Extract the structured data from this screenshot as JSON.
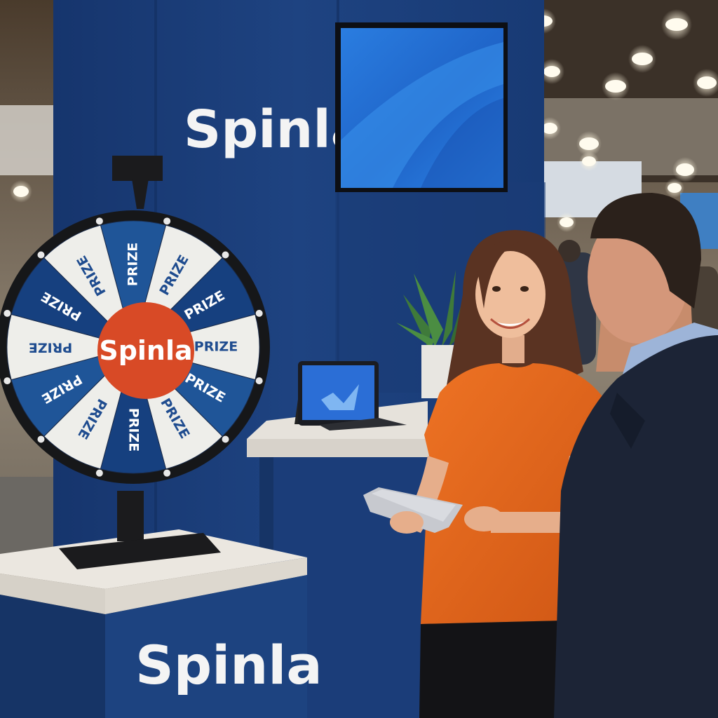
{
  "booth": {
    "brand_top": "Spinla",
    "brand_pedestal": "Spinla",
    "wheel_hub": "Spinla",
    "wheel_segments": [
      "PRIZE",
      "PRIZE",
      "PRIZE",
      "PRIZE",
      "PRIZE",
      "PRIZE",
      "PRIZE",
      "PRIZE",
      "PRIZE",
      "PRIZE",
      "PRIZE",
      "PRIZE"
    ]
  },
  "colors": {
    "booth_blue": "#1d3f7a",
    "wheel_blue": "#1f5598",
    "wheel_white": "#eeeeea",
    "hub_orange": "#d84a26",
    "shirt_orange": "#e46419"
  }
}
